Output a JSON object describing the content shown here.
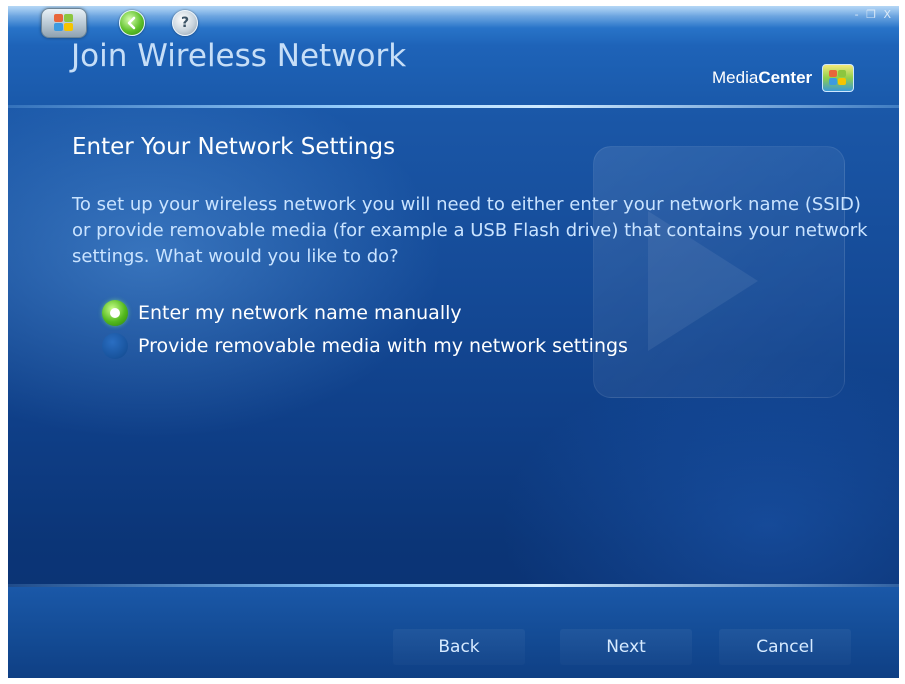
{
  "window": {
    "controls": "- ❐ X"
  },
  "header": {
    "title": "Join Wireless Network",
    "brand_prefix": "Media",
    "brand_suffix": "Center"
  },
  "icons": {
    "start": "windows-flag-icon",
    "back": "back-arrow-icon",
    "help": "help-icon"
  },
  "main": {
    "section_title": "Enter Your Network Settings",
    "instructions": "To set up your wireless network you will need to either enter your network name (SSID) or provide removable media (for example a USB Flash drive) that contains your network settings. What would you like to do?",
    "options": [
      {
        "label": "Enter my network name manually",
        "selected": true
      },
      {
        "label": "Provide removable media with my network settings",
        "selected": false
      }
    ]
  },
  "footer": {
    "back_label": "Back",
    "next_label": "Next",
    "cancel_label": "Cancel"
  },
  "colors": {
    "background": "#154b98",
    "accent": "#53b91e",
    "text": "#ffffff",
    "text_secondary": "#c9e3ff"
  }
}
